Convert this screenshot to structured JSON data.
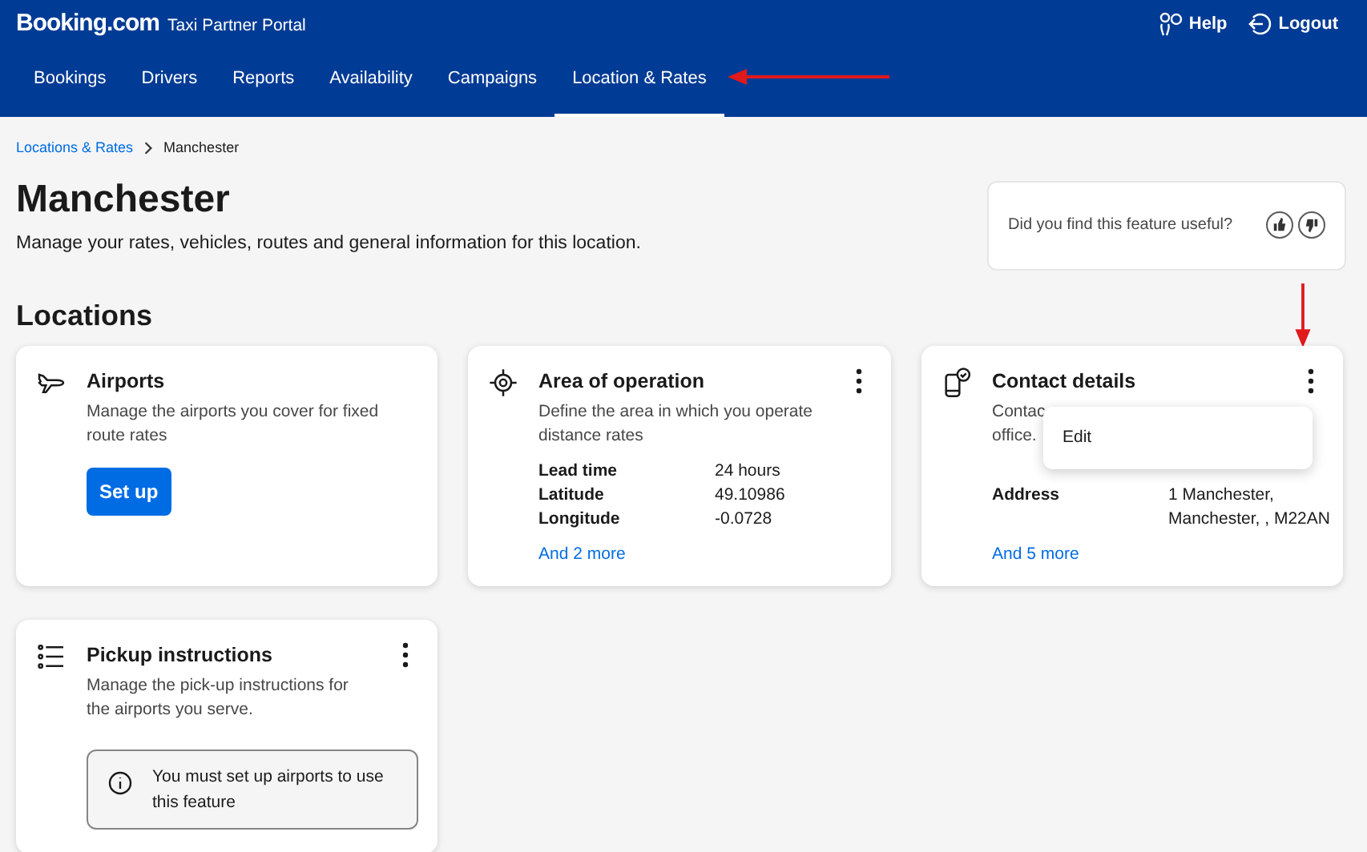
{
  "header": {
    "logo": "Booking.com",
    "product": "Taxi Partner Portal",
    "help": "Help",
    "logout": "Logout"
  },
  "nav": [
    {
      "label": "Bookings",
      "selected": false
    },
    {
      "label": "Drivers",
      "selected": false
    },
    {
      "label": "Reports",
      "selected": false
    },
    {
      "label": "Availability",
      "selected": false
    },
    {
      "label": "Campaigns",
      "selected": false
    },
    {
      "label": "Location & Rates",
      "selected": true
    }
  ],
  "breadcrumb": {
    "link": "Locations & Rates",
    "current": "Manchester"
  },
  "title": "Manchester",
  "subtitle": "Manage your rates, vehicles, routes and general information for this location.",
  "feedback": {
    "question": "Did you find this feature useful?"
  },
  "section_title": "Locations",
  "cards": [
    {
      "kind": "plane",
      "title": "Airports",
      "description": [
        "Manage the airports you cover for fixed",
        "route rates"
      ],
      "button": "Set up"
    },
    {
      "kind": "target",
      "title": "Area of operation",
      "menu": true,
      "description": [
        "Define the area in which you operate",
        "distance rates"
      ],
      "details": [
        {
          "label": "Lead time",
          "value": [
            "24 hours"
          ]
        },
        {
          "label": "Latitude",
          "value": [
            "49.10986"
          ]
        },
        {
          "label": "Longitude",
          "value": [
            "-0.0728"
          ]
        }
      ],
      "more": "And 2 more"
    },
    {
      "kind": "phone",
      "title": "Contact details",
      "menu": true,
      "description": [
        "Contac",
        "office."
      ],
      "details": [
        {
          "label": "Address",
          "value": [
            "1 Manchester,",
            "Manchester, , M22AN"
          ]
        }
      ],
      "more": "And 5 more",
      "popup": [
        "Edit"
      ]
    },
    {
      "kind": "list",
      "title": "Pickup instructions",
      "menu": true,
      "description": [
        "Manage the pick-up instructions for",
        "the airports you serve."
      ],
      "notice": "You must set up airports to use this feature"
    }
  ]
}
